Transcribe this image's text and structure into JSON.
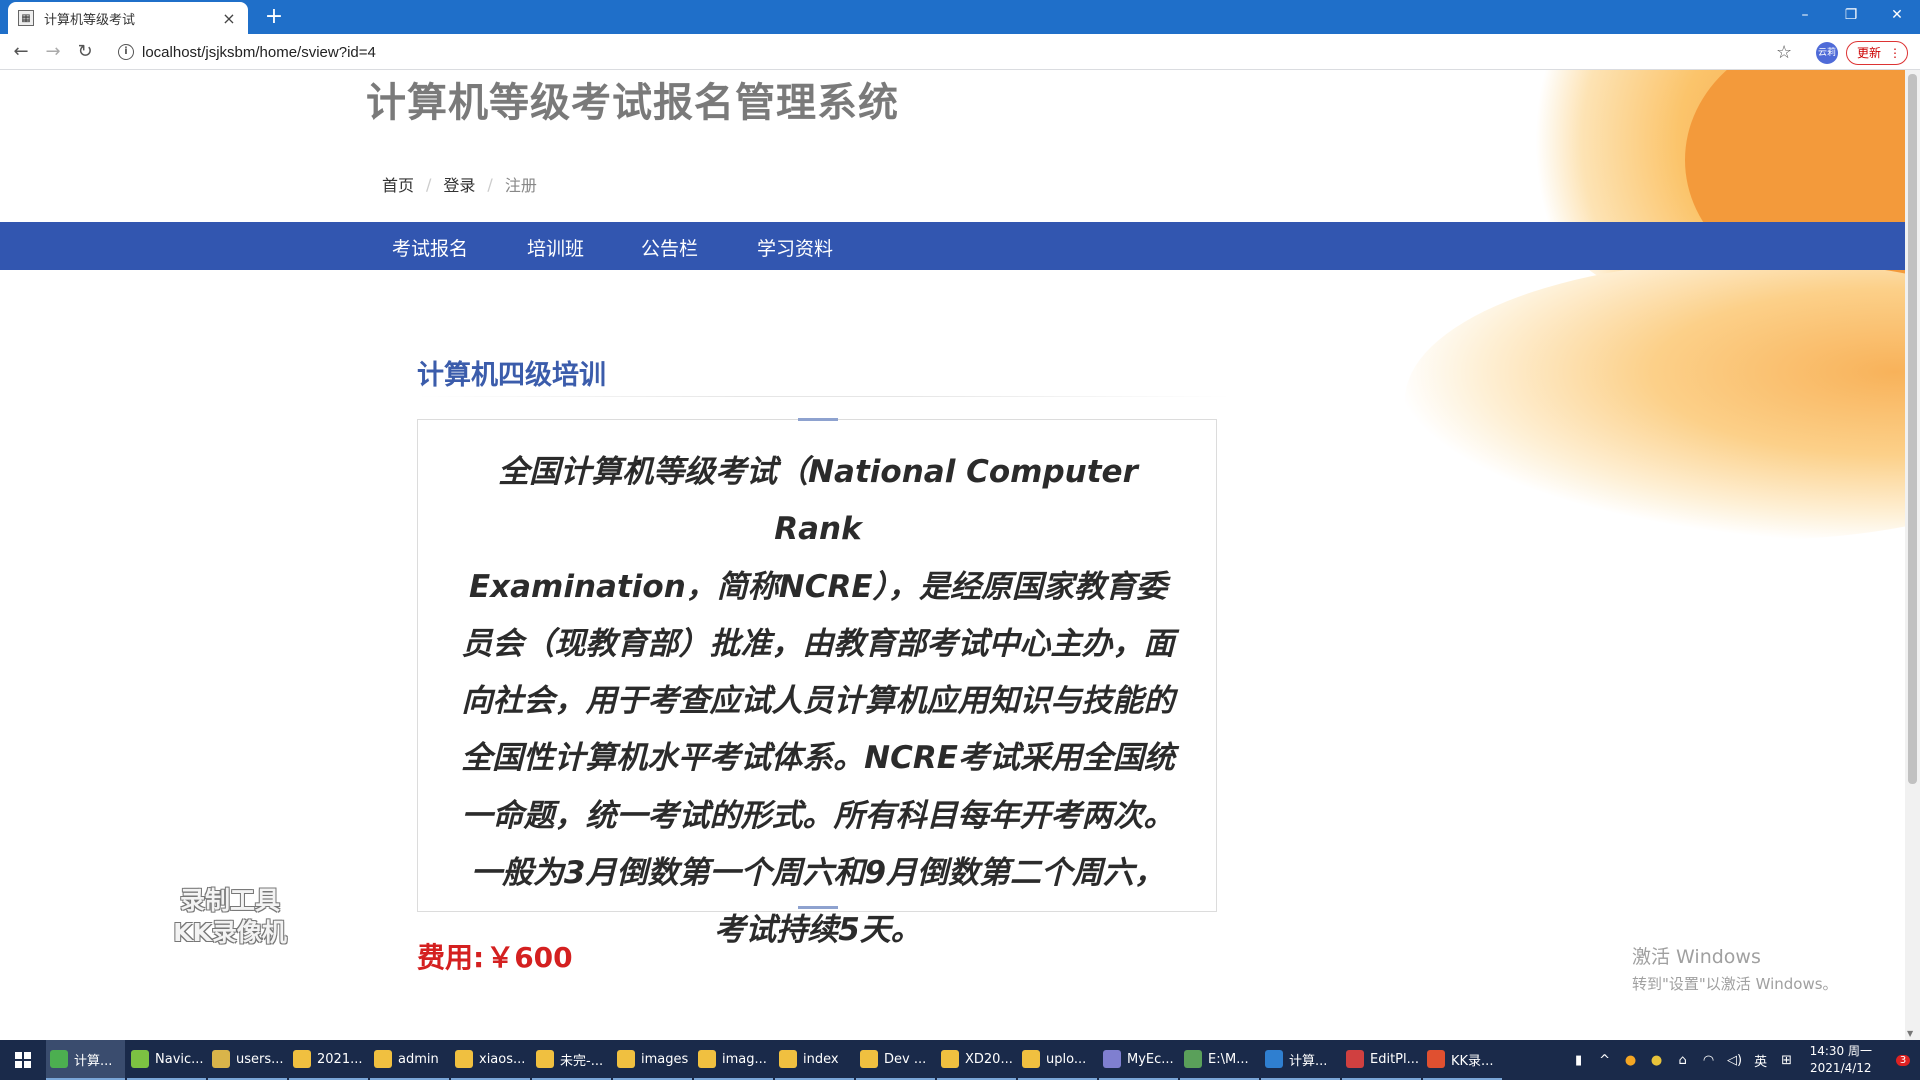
{
  "browser": {
    "tab_title": "计算机等级考试",
    "tab_close": "×",
    "new_tab": "+",
    "url": "localhost/jsjksbm/home/sview?id=4",
    "profile": "云莉",
    "update_label": "更新",
    "window_controls": [
      "–",
      "❐",
      "✕"
    ]
  },
  "site": {
    "title": "计算机等级考试报名管理系统",
    "breadcrumb": [
      "首页",
      "登录",
      "注册"
    ],
    "nav": [
      "考试报名",
      "培训班",
      "公告栏",
      "学习资料"
    ]
  },
  "article": {
    "title": "计算机四级培训",
    "lines": [
      "全国计算机等级考试（National Computer Rank",
      "Examination，简称NCRE），是经原国家教育委",
      "员会（现教育部）批准，由教育部考试中心主办，面",
      "向社会，用于考查应试人员计算机应用知识与技能的",
      "全国性计算机水平考试体系。NCRE考试采用全国统",
      "一命题，统一考试的形式。所有科目每年开考两次。",
      "一般为3月倒数第一个周六和9月倒数第二个周六，",
      "考试持续5天。"
    ],
    "fee_label": "费用:",
    "fee_value": "￥600"
  },
  "overlay": {
    "recorder_line1": "录制工具",
    "recorder_line2": "KK录像机",
    "activate_line1": "激活 Windows",
    "activate_line2": "转到\"设置\"以激活 Windows。"
  },
  "taskbar": {
    "items": [
      {
        "label": "计算...",
        "color": "#4caf50"
      },
      {
        "label": "Navic...",
        "color": "#7cc242"
      },
      {
        "label": "users...",
        "color": "#d9b44a"
      },
      {
        "label": "2021...",
        "color": "#f0c040"
      },
      {
        "label": "admin",
        "color": "#f0c040"
      },
      {
        "label": "xiaos...",
        "color": "#f0c040"
      },
      {
        "label": "未完-...",
        "color": "#f0c040"
      },
      {
        "label": "images",
        "color": "#f0c040"
      },
      {
        "label": "imag...",
        "color": "#f0c040"
      },
      {
        "label": "index",
        "color": "#f0c040"
      },
      {
        "label": "Dev ...",
        "color": "#f0c040"
      },
      {
        "label": "XD20...",
        "color": "#f0c040"
      },
      {
        "label": "uplo...",
        "color": "#f0c040"
      },
      {
        "label": "MyEc...",
        "color": "#7f7fd0"
      },
      {
        "label": "E:\\M...",
        "color": "#5aa05a"
      },
      {
        "label": "计算...",
        "color": "#2f7fd0"
      },
      {
        "label": "EditPl...",
        "color": "#d04040"
      },
      {
        "label": "KK录...",
        "color": "#e05030"
      }
    ],
    "ime": "英",
    "time": "14:30 周一",
    "date": "2021/4/12",
    "notification_count": "3"
  }
}
